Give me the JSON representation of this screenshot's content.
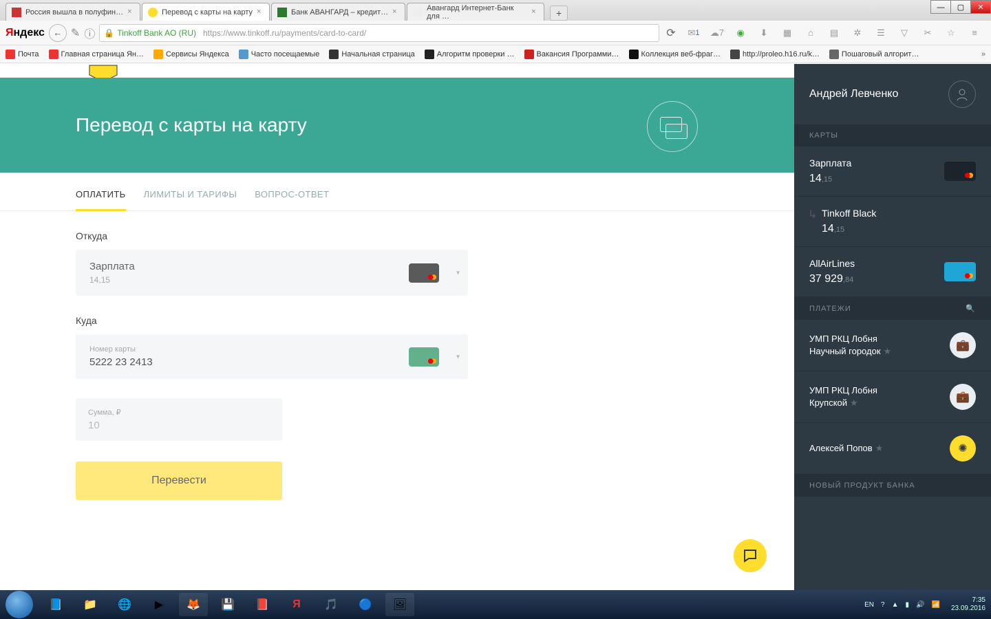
{
  "tabs": [
    {
      "title": "Россия вышла в полуфин…"
    },
    {
      "title": "Перевод с карты на карту"
    },
    {
      "title": "Банк АВАНГАРД – кредит…"
    },
    {
      "title": "Авангард Интернет-Банк для …"
    }
  ],
  "active_tab_index": 1,
  "addr": {
    "site_id": "Tinkoff Bank AO (RU)",
    "url": "https://www.tinkoff.ru/payments/card-to-card/",
    "mail_count": "1",
    "weather": "7"
  },
  "bookmarks": [
    "Почта",
    "Главная страница Ян…",
    "Сервисы Яндекса",
    "Часто посещаемые",
    "Начальная страница",
    "Алгоритм проверки …",
    "Вакансия Программи…",
    "Коллекция веб-фраг…",
    "http://proleo.h16.ru/k…",
    "Пошаговый алгорит…"
  ],
  "hero": {
    "title": "Перевод с карты на карту"
  },
  "subtabs": [
    {
      "label": "ОПЛАТИТЬ",
      "active": true
    },
    {
      "label": "ЛИМИТЫ И ТАРИФЫ",
      "active": false
    },
    {
      "label": "ВОПРОС-ОТВЕТ",
      "active": false
    }
  ],
  "form": {
    "from_label": "Откуда",
    "from_name": "Зарплата",
    "from_balance_int": "14",
    "from_balance_dec": ",15",
    "to_label": "Куда",
    "card_label": "Номер карты",
    "card_value": "5222 23           2413",
    "amount_label": "Сумма, ₽",
    "amount_value": "10",
    "submit": "Перевести"
  },
  "sidebar": {
    "user": "Андрей Левченко",
    "cards_header": "КАРТЫ",
    "cards": [
      {
        "name": "Зарплата",
        "int": "14",
        "dec": ",15",
        "chip": "dark"
      },
      {
        "name": "Tinkoff Black",
        "int": "14",
        "dec": ",15",
        "indent": true
      },
      {
        "name": "AllAirLines",
        "int": "37 929",
        "dec": ",84",
        "chip": "blue"
      }
    ],
    "payments_header": "ПЛАТЕЖИ",
    "payments": [
      {
        "t1": "УМП РКЦ Лобня",
        "t2": "Научный городок"
      },
      {
        "t1": "УМП РКЦ Лобня",
        "t2": "Крупской"
      },
      {
        "t1": "Алексей Попов",
        "t2": "",
        "y": true
      }
    ],
    "new_prod": "НОВЫЙ ПРОДУКТ БАНКА"
  },
  "tray": {
    "lang": "EN",
    "time": "7:35",
    "date": "23.09.2016"
  }
}
